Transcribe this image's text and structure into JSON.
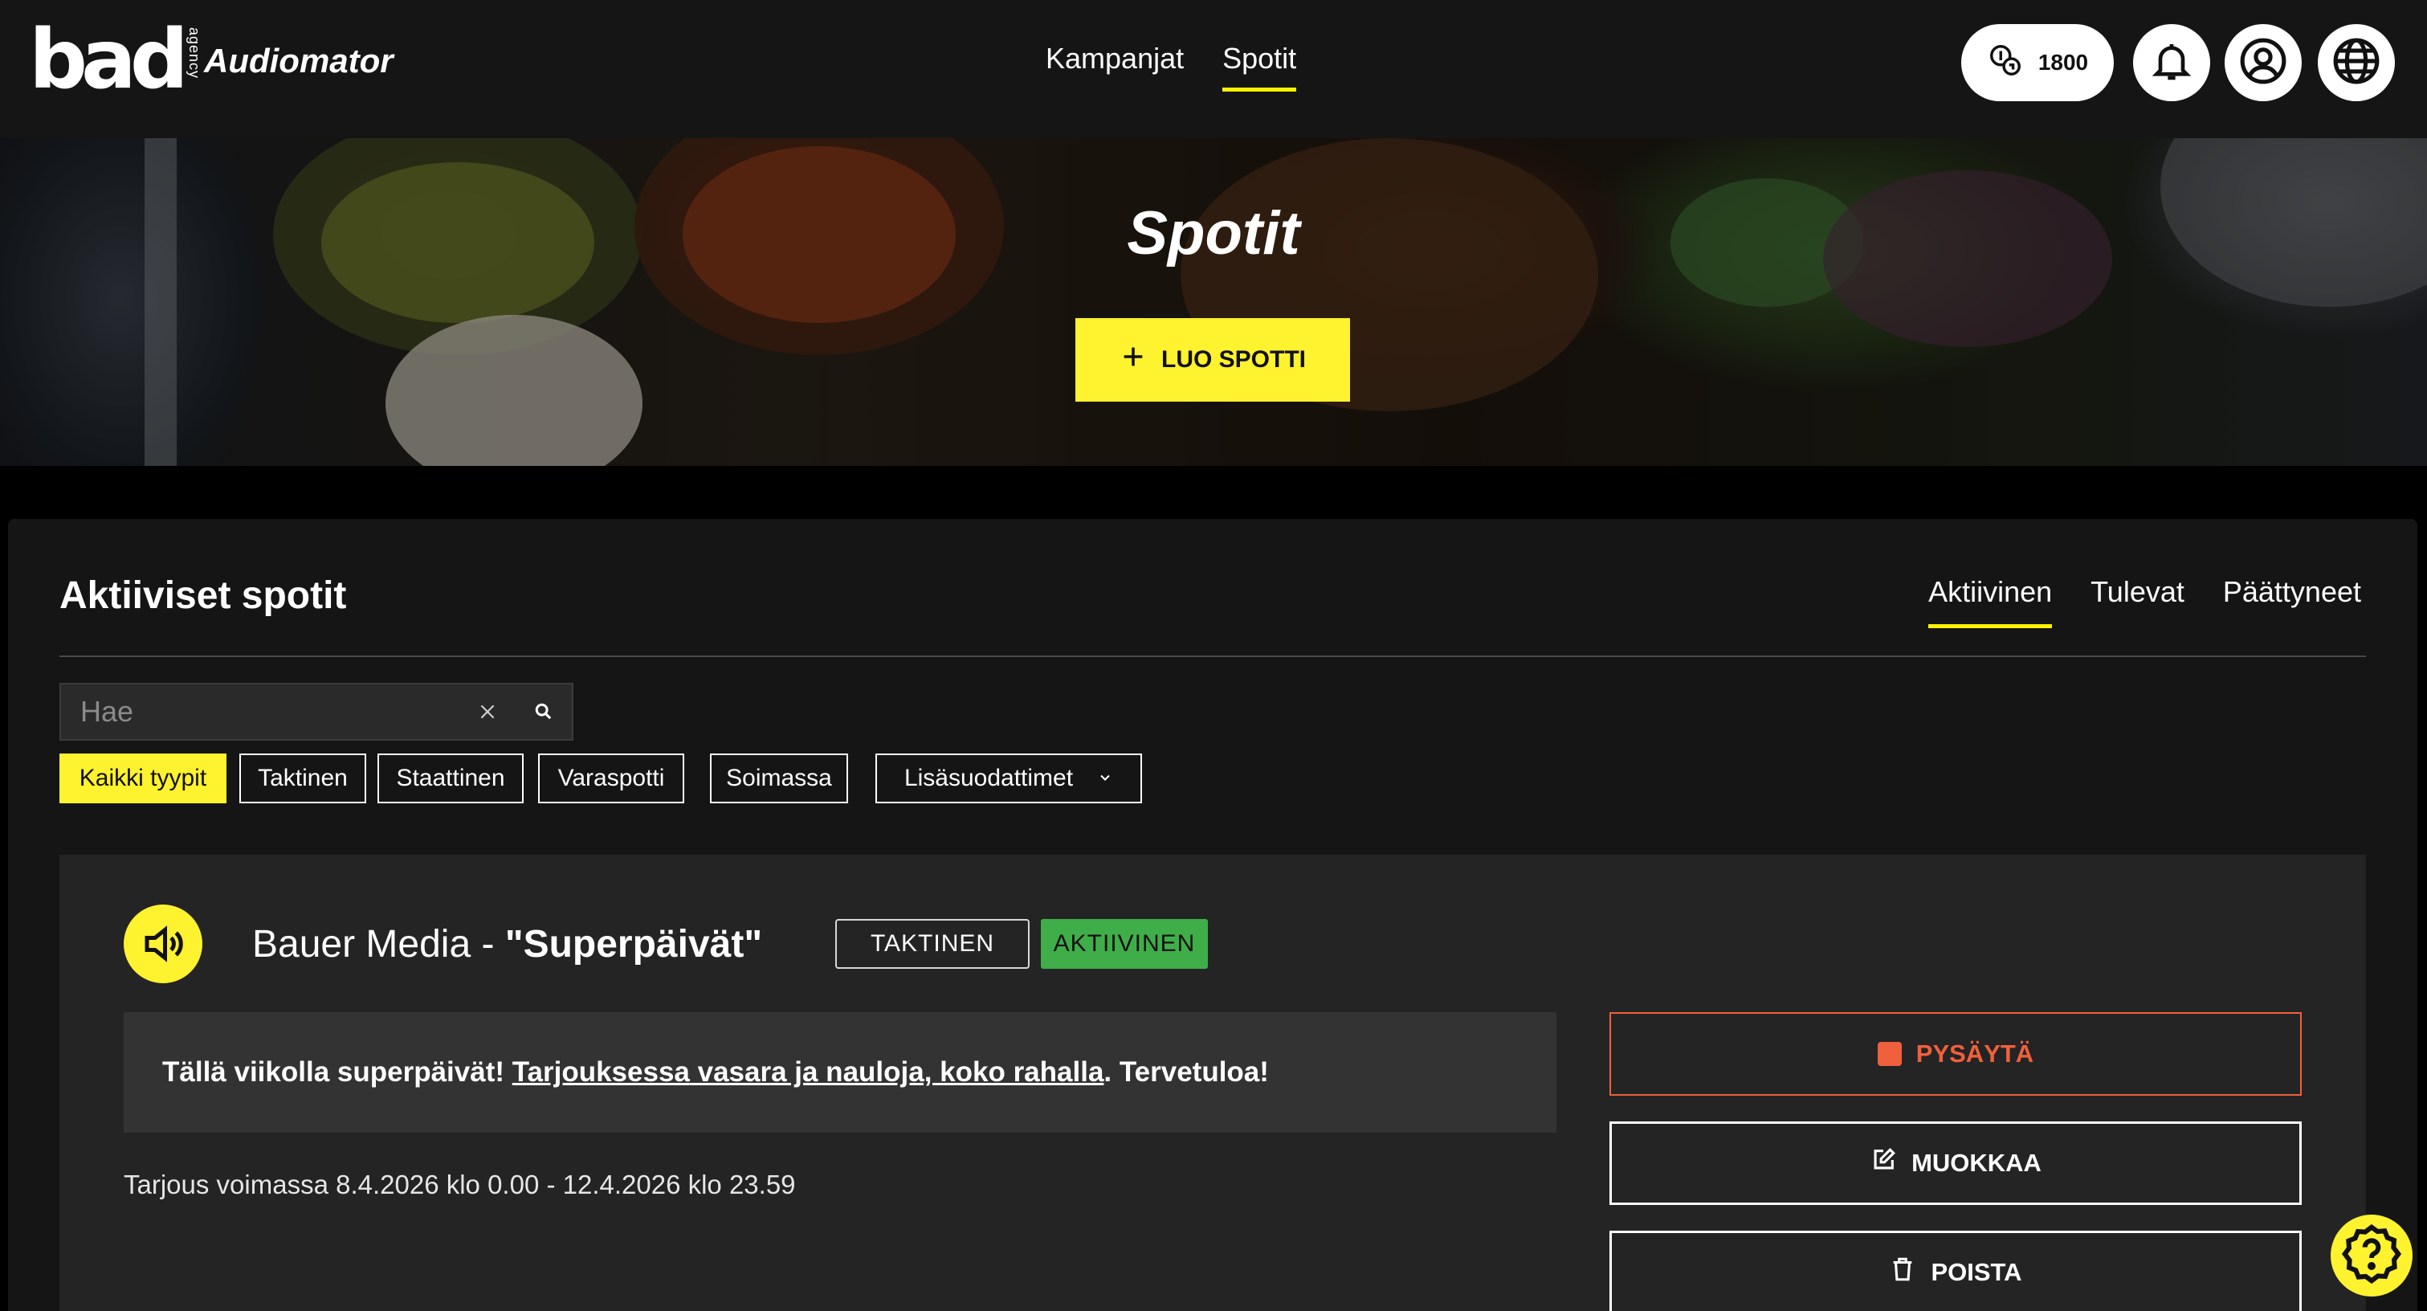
{
  "header": {
    "logo_text": "bad",
    "logo_sub": "agency",
    "app_name": "Audiomator",
    "nav": [
      {
        "label": "Kampanjat",
        "active": false
      },
      {
        "label": "Spotit",
        "active": true
      }
    ],
    "credits": "1800",
    "icons": [
      "coins-icon",
      "bell-icon",
      "user-icon",
      "globe-icon"
    ]
  },
  "hero": {
    "title": "Spotit",
    "create_button": "LUO SPOTTI"
  },
  "panel": {
    "title": "Aktiiviset spotit",
    "tabs": [
      {
        "label": "Aktiivinen",
        "active": true
      },
      {
        "label": "Tulevat",
        "active": false
      },
      {
        "label": "Päättyneet",
        "active": false
      }
    ],
    "search": {
      "placeholder": "Hae",
      "value": ""
    },
    "filters": [
      {
        "label": "Kaikki tyypit",
        "active": true
      },
      {
        "label": "Taktinen",
        "active": false
      },
      {
        "label": "Staattinen",
        "active": false
      },
      {
        "label": "Varaspotti",
        "active": false
      },
      {
        "label": "Soimassa",
        "active": false
      },
      {
        "label": "Lisäsuodattimet",
        "active": false,
        "dropdown": true
      }
    ]
  },
  "spot": {
    "title_plain": "Bauer Media - ",
    "title_bold": "\"Superpäivät\"",
    "type_badge": "TAKTINEN",
    "status_badge": "AKTIIVINEN",
    "message_prefix": "Tällä viikolla superpäivät! ",
    "message_link": "Tarjouksessa vasara ja nauloja, koko rahalla",
    "message_suffix": ". Tervetuloa!",
    "validity": "Tarjous voimassa 8.4.2026 klo 0.00 - 12.4.2026 klo 23.59",
    "actions": {
      "stop": "PYSÄYTÄ",
      "edit": "MUOKKAA",
      "delete": "POISTA"
    }
  },
  "colors": {
    "accent": "#fff22e",
    "stop": "#f0603c",
    "active_badge": "#3fae49",
    "header_bg": "#151515",
    "card_bg": "#242424"
  }
}
